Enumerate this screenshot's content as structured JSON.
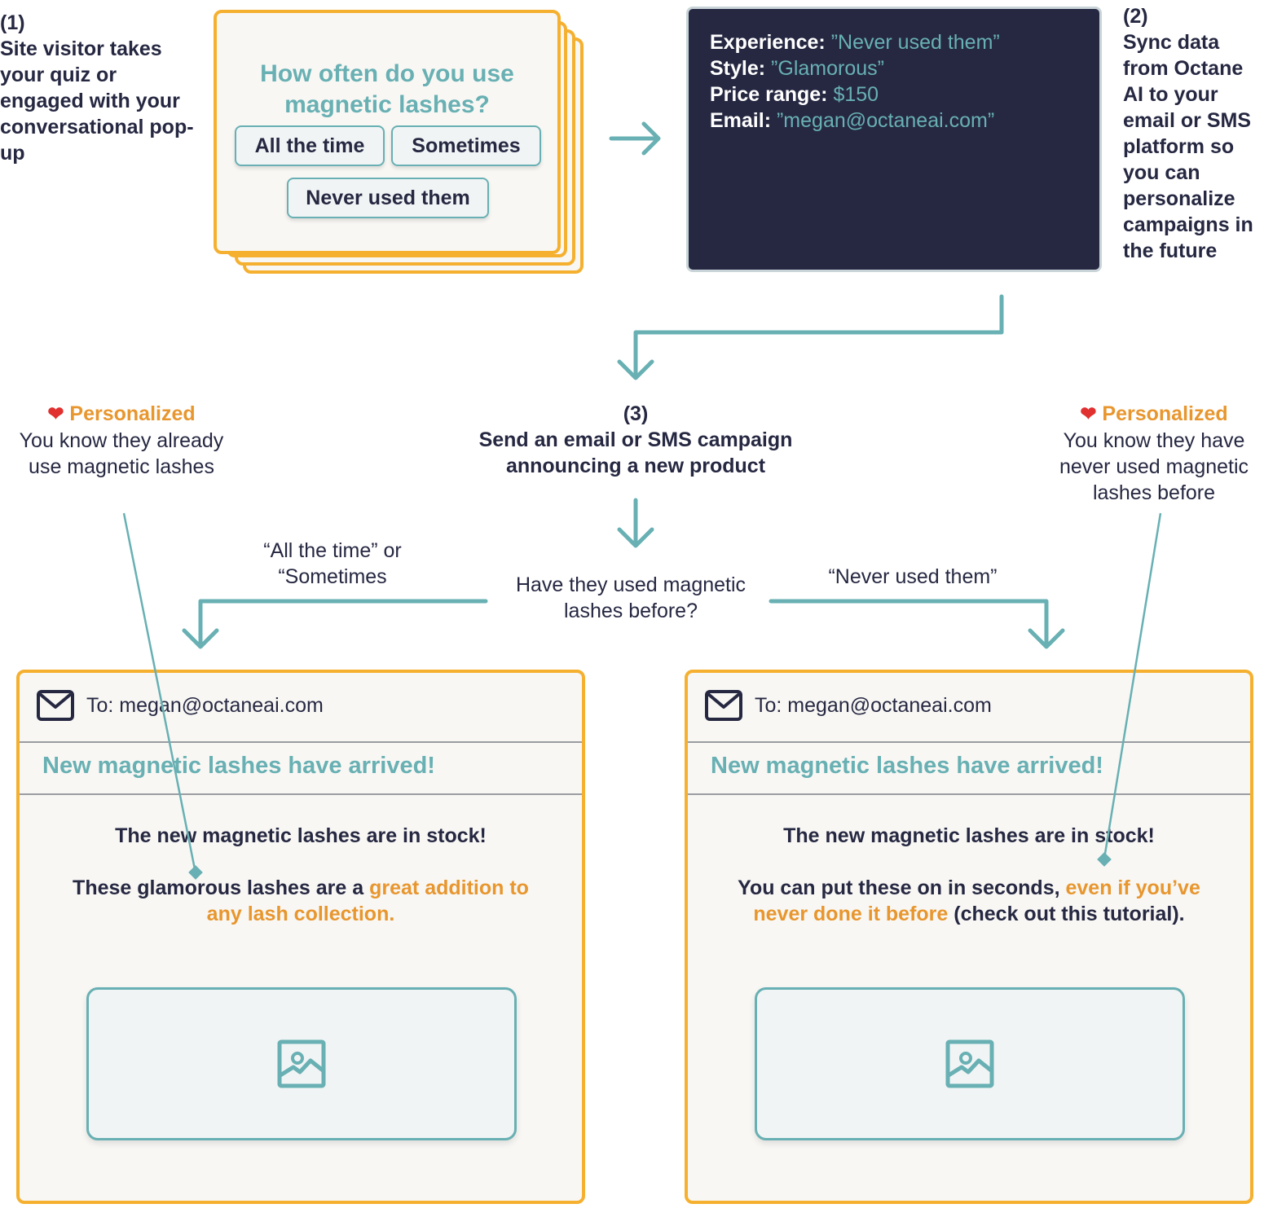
{
  "step1": {
    "number": "(1)",
    "text": "Site visitor takes your quiz or engaged with your conversational pop-up"
  },
  "quiz": {
    "question": "How often do you use magnetic lashes?",
    "options": [
      "All the time",
      "Sometimes",
      "Never used them"
    ]
  },
  "data_box": {
    "rows": [
      {
        "key": "Experience:",
        "value": "”Never used them”"
      },
      {
        "key": "Style:",
        "value": "”Glamorous”"
      },
      {
        "key": "Price range:",
        "value": "$150"
      },
      {
        "key": "Email:",
        "value": "”megan@octaneai.com”"
      }
    ]
  },
  "step2": {
    "number": "(2)",
    "text": "Sync data from Octane AI to your email or SMS platform so you can personalize campaigns in the future"
  },
  "step3": {
    "number": "(3)",
    "text": "Send an email or SMS campaign announcing a new product"
  },
  "decision": {
    "question": "Have they used magnetic lashes before?",
    "left_branch": "“All the time” or “Sometimes",
    "right_branch": "“Never used them”"
  },
  "annotations": {
    "left": {
      "icon": "heart-icon",
      "title": "Personalized",
      "text": "You know they already use magnetic lashes"
    },
    "right": {
      "icon": "heart-icon",
      "title": "Personalized",
      "text": "You know they have never used magnetic lashes before"
    }
  },
  "emails": {
    "left": {
      "to": "To: megan@octaneai.com",
      "subject": "New magnetic lashes have arrived!",
      "line1": "The new magnetic lashes are in stock!",
      "line2_plain": "These glamorous lashes are a ",
      "line2_highlight": "great addition to any lash collection.",
      "line2_tail": ""
    },
    "right": {
      "to": "To: megan@octaneai.com",
      "subject": "New magnetic lashes have arrived!",
      "line1": "The new magnetic lashes are in stock!",
      "line2_plain": "You can put these on in seconds, ",
      "line2_highlight": "even if you’ve never done it before",
      "line2_tail": " (check out this tutorial)."
    }
  },
  "colors": {
    "teal": "#68B0B3",
    "orange_border": "#F5B030",
    "orange_text": "#E8962E",
    "navy": "#262842",
    "card_bg": "#F8F7F4"
  }
}
